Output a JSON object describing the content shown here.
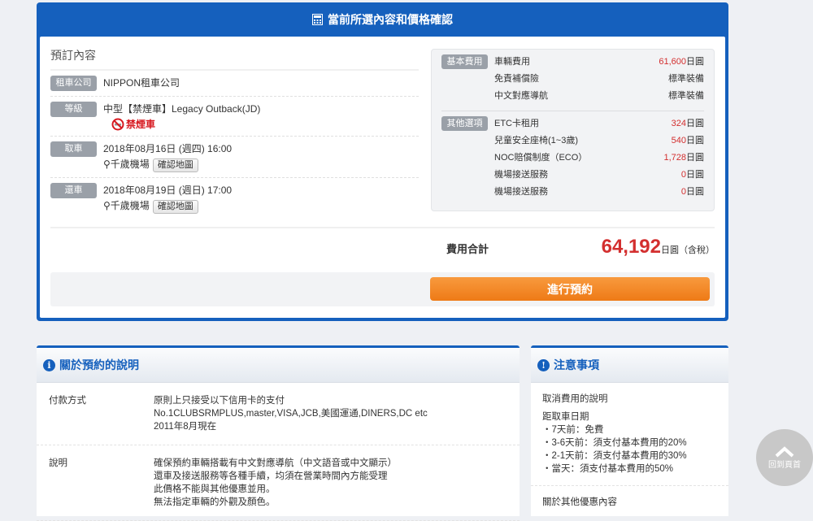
{
  "confirm_panel": {
    "title": "當前所選內容和價格確認",
    "icon": "calculator-icon"
  },
  "booking": {
    "title": "預訂內容",
    "company": {
      "label": "租車公司",
      "value": "NIPPON租車公司"
    },
    "class": {
      "label": "等級",
      "value": "中型【禁煙車】Legacy Outback(JD)",
      "badge": "禁煙車"
    },
    "pickup": {
      "label": "取車",
      "datetime": "2018年08月16日 (週四) 16:00",
      "location": "千歲機場",
      "map_button": "確認地圖"
    },
    "return": {
      "label": "還車",
      "datetime": "2018年08月19日 (週日) 17:00",
      "location": "千歲機場",
      "map_button": "確認地圖"
    }
  },
  "fees": {
    "basic": {
      "label": "基本費用",
      "items": [
        {
          "name": "車輛費用",
          "amount": "61,600",
          "unit": "日圓"
        },
        {
          "name": "免責補償險",
          "amount": "",
          "unit": "標準裝備"
        },
        {
          "name": "中文對應導航",
          "amount": "",
          "unit": "標準裝備"
        }
      ]
    },
    "options": {
      "label": "其他選項",
      "items": [
        {
          "name": "ETC卡租用",
          "amount": "324",
          "unit": "日圓"
        },
        {
          "name": "兒童安全座椅(1~3歲)",
          "amount": "540",
          "unit": "日圓"
        },
        {
          "name": "NOC賠償制度（ECO）",
          "amount": "1,728",
          "unit": "日圓"
        },
        {
          "name": "機場接送服務",
          "amount": "0",
          "unit": "日圓"
        },
        {
          "name": "機場接送服務",
          "amount": "0",
          "unit": "日圓"
        }
      ]
    },
    "total_label": "費用合計",
    "total": "64,192",
    "total_unit": "日圓（含稅）"
  },
  "book_button": "進行預約",
  "about": {
    "title": "關於預約的說明",
    "rows": [
      {
        "key": "付款方式",
        "lines": [
          "原則上只接受以下信用卡的支付",
          "No.1CLUBSRMPLUS,master,VISA,JCB,美國運通,DINERS,DC etc",
          "2011年8月現在"
        ]
      },
      {
        "key": "說明",
        "lines": [
          "確保預約車輛搭載有中文對應導航（中文語音或中文顯示）",
          "還車及接送服務等各種手續，均須在營業時間內方能受理",
          "此價格不能與其他優惠並用。",
          "無法指定車輛的外觀及顏色。"
        ]
      }
    ]
  },
  "notes": {
    "title": "注意事項",
    "cancel_title": "取消費用的說明",
    "cancel_sub": "距取車日期",
    "cancel_items": [
      "・7天前：免費",
      "・3-6天前：須支付基本費用的20%",
      "・2-1天前：須支付基本費用的30%",
      "・當天：須支付基本費用的50%"
    ],
    "other_title": "關於其他優惠內容"
  },
  "back_to_top": "回到頁首",
  "colors": {
    "primary": "#1560bd",
    "accent": "#ee7a16",
    "price": "#d32f2f"
  }
}
